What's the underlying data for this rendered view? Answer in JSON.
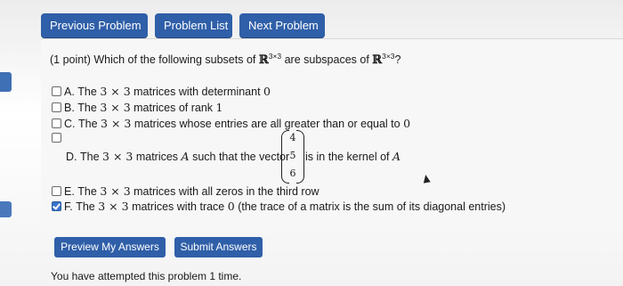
{
  "nav": {
    "previous": "Previous Problem",
    "list": "Problem List",
    "next": "Next Problem"
  },
  "question": {
    "points": "(1 point)",
    "text": "Which of the following subsets of",
    "space_symbol": "ℝ",
    "space_exp": "3×3",
    "text_mid": "are subspaces of",
    "end": "?"
  },
  "options": [
    {
      "letter": "A.",
      "pre": "The",
      "dims": "3 × 3",
      "post": "matrices with determinant",
      "value": "0",
      "checked": false
    },
    {
      "letter": "B.",
      "pre": "The",
      "dims": "3 × 3",
      "post": "matrices of rank",
      "value": "1",
      "checked": false
    },
    {
      "letter": "C.",
      "pre": "The",
      "dims": "3 × 3",
      "post": "matrices whose entries are all greater than or equal to",
      "value": "0",
      "checked": false
    },
    {
      "letter": "D.",
      "pre": "The",
      "dims": "3 × 3",
      "post": "matrices",
      "var": "A",
      "post2": "such that the vector",
      "vector": [
        "4",
        "5",
        "6"
      ],
      "post3": "is in the kernel of",
      "var2": "A",
      "checked": false
    },
    {
      "letter": "E.",
      "pre": "The",
      "dims": "3 × 3",
      "post": "matrices with all zeros in the third row",
      "checked": false
    },
    {
      "letter": "F.",
      "pre": "The",
      "dims": "3 × 3",
      "post": "matrices with trace",
      "value": "0",
      "post2": "(the trace of a matrix is the sum of its diagonal entries)",
      "checked": true
    }
  ],
  "actions": {
    "preview": "Preview My Answers",
    "submit": "Submit Answers"
  },
  "status": "You have attempted this problem 1 time.",
  "colors": {
    "button": "#2f5fa8",
    "checkbox_checked": "#3a72c8",
    "side_bar": "#3f6fb4"
  }
}
